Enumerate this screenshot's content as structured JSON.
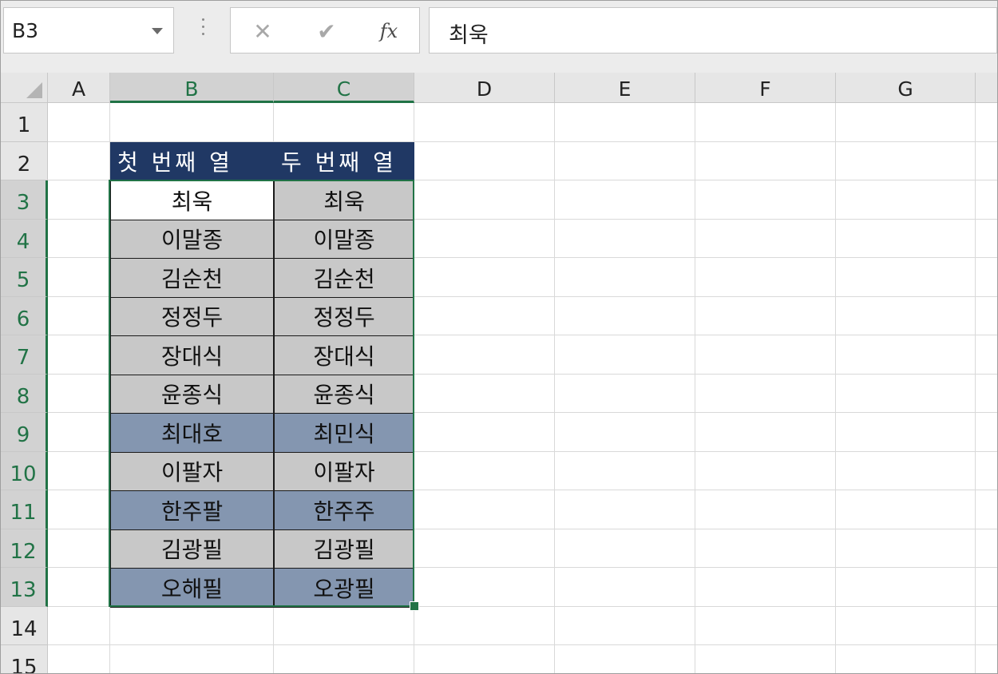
{
  "formula_bar": {
    "name_box": "B3",
    "cancel_glyph": "✕",
    "enter_glyph": "✔",
    "fx_glyph": "fx",
    "formula_value": "최욱"
  },
  "columns": [
    "A",
    "B",
    "C",
    "D",
    "E",
    "F",
    "G"
  ],
  "selected_columns": [
    "B",
    "C"
  ],
  "rows": [
    "1",
    "2",
    "3",
    "4",
    "5",
    "6",
    "7",
    "8",
    "9",
    "10",
    "11",
    "12",
    "13",
    "14",
    "15"
  ],
  "table": {
    "headers": [
      "첫 번째 열",
      "두 번째 열"
    ],
    "data": [
      {
        "b": "최욱",
        "c": "최욱",
        "fill_b": "white",
        "fill_c": "gray"
      },
      {
        "b": "이말종",
        "c": "이말종",
        "fill_b": "gray",
        "fill_c": "gray"
      },
      {
        "b": "김순천",
        "c": "김순천",
        "fill_b": "gray",
        "fill_c": "gray"
      },
      {
        "b": "정정두",
        "c": "정정두",
        "fill_b": "gray",
        "fill_c": "gray"
      },
      {
        "b": "장대식",
        "c": "장대식",
        "fill_b": "gray",
        "fill_c": "gray"
      },
      {
        "b": "윤종식",
        "c": "윤종식",
        "fill_b": "gray",
        "fill_c": "gray"
      },
      {
        "b": "최대호",
        "c": "최민식",
        "fill_b": "blue",
        "fill_c": "blue"
      },
      {
        "b": "이팔자",
        "c": "이팔자",
        "fill_b": "gray",
        "fill_c": "gray"
      },
      {
        "b": "한주팔",
        "c": "한주주",
        "fill_b": "blue",
        "fill_c": "blue"
      },
      {
        "b": "김광필",
        "c": "김광필",
        "fill_b": "gray",
        "fill_c": "gray"
      },
      {
        "b": "오해필",
        "c": "오광필",
        "fill_b": "blue",
        "fill_c": "blue"
      }
    ]
  },
  "colors": {
    "header_fill": "#203864",
    "match_fill": "#c8c8c8",
    "diff_fill": "#8496b0",
    "selection": "#217346"
  }
}
